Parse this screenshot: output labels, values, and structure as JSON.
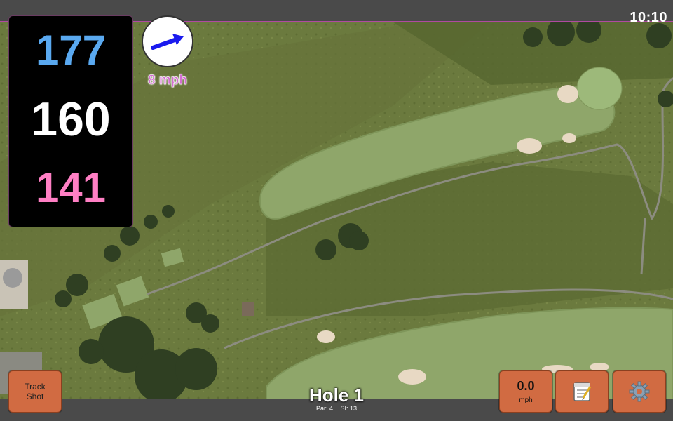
{
  "status": {
    "time": "10:10"
  },
  "distances": {
    "back": "177",
    "middle": "160",
    "front": "141"
  },
  "wind": {
    "speed": "8 mph",
    "icon": "wind-direction-arrow-icon"
  },
  "hole": {
    "title": "Hole 1",
    "par": "Par: 4",
    "stroke_index": "SI: 13"
  },
  "buttons": {
    "track_shot": "Track Shot",
    "wind_value": "0.0",
    "wind_unit": "mph",
    "notes_icon": "notepad-icon",
    "settings_icon": "gear-icon"
  },
  "colors": {
    "back": "#5aa9f0",
    "middle": "#ffffff",
    "front": "#ff7fc4",
    "button": "#d16b42",
    "wind_text": "#d36fd0"
  }
}
